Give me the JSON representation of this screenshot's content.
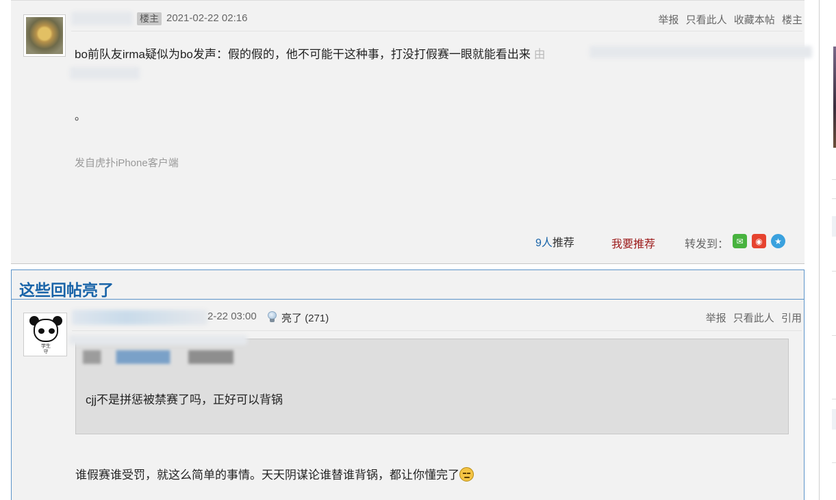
{
  "op": {
    "badge": "楼主",
    "time": "2021-02-22 02:16",
    "actions": [
      "举报",
      "只看此人",
      "收藏本帖",
      "楼主"
    ],
    "body": "bo前队友irma疑似为bo发声：假的假的，他不可能干这种事，打没打假赛一眼就能看出来",
    "by_label": "由",
    "dot": "。",
    "source": "发自虎扑iPhone客户端",
    "recommend_count": "9人",
    "recommend_suffix": "推荐",
    "recommend_button": "我要推荐",
    "share_label": "转发到："
  },
  "highlight": {
    "title": "这些回帖亮了",
    "reply": {
      "time": "2-22 03:00",
      "liang_label": "亮了",
      "liang_count": "(271)",
      "actions": [
        "举报",
        "只看此人",
        "引用"
      ],
      "quote_text": "cjj不是拼惩被禁赛了吗，正好可以背锅",
      "body": "谁假赛谁受罚，就这么简单的事情。天天阴谋论谁替谁背锅，都让你懂完了"
    }
  },
  "icons": {
    "wechat": "wechat-icon",
    "weibo": "weibo-icon",
    "qzone": "qzone-icon",
    "bulb": "lightbulb-icon",
    "emoji": "sad-face-icon"
  },
  "colors": {
    "accent_blue": "#1863a8",
    "recommend_red": "#9c1a1a",
    "post_bg": "#f2f2f2",
    "quote_bg": "#dedede"
  }
}
